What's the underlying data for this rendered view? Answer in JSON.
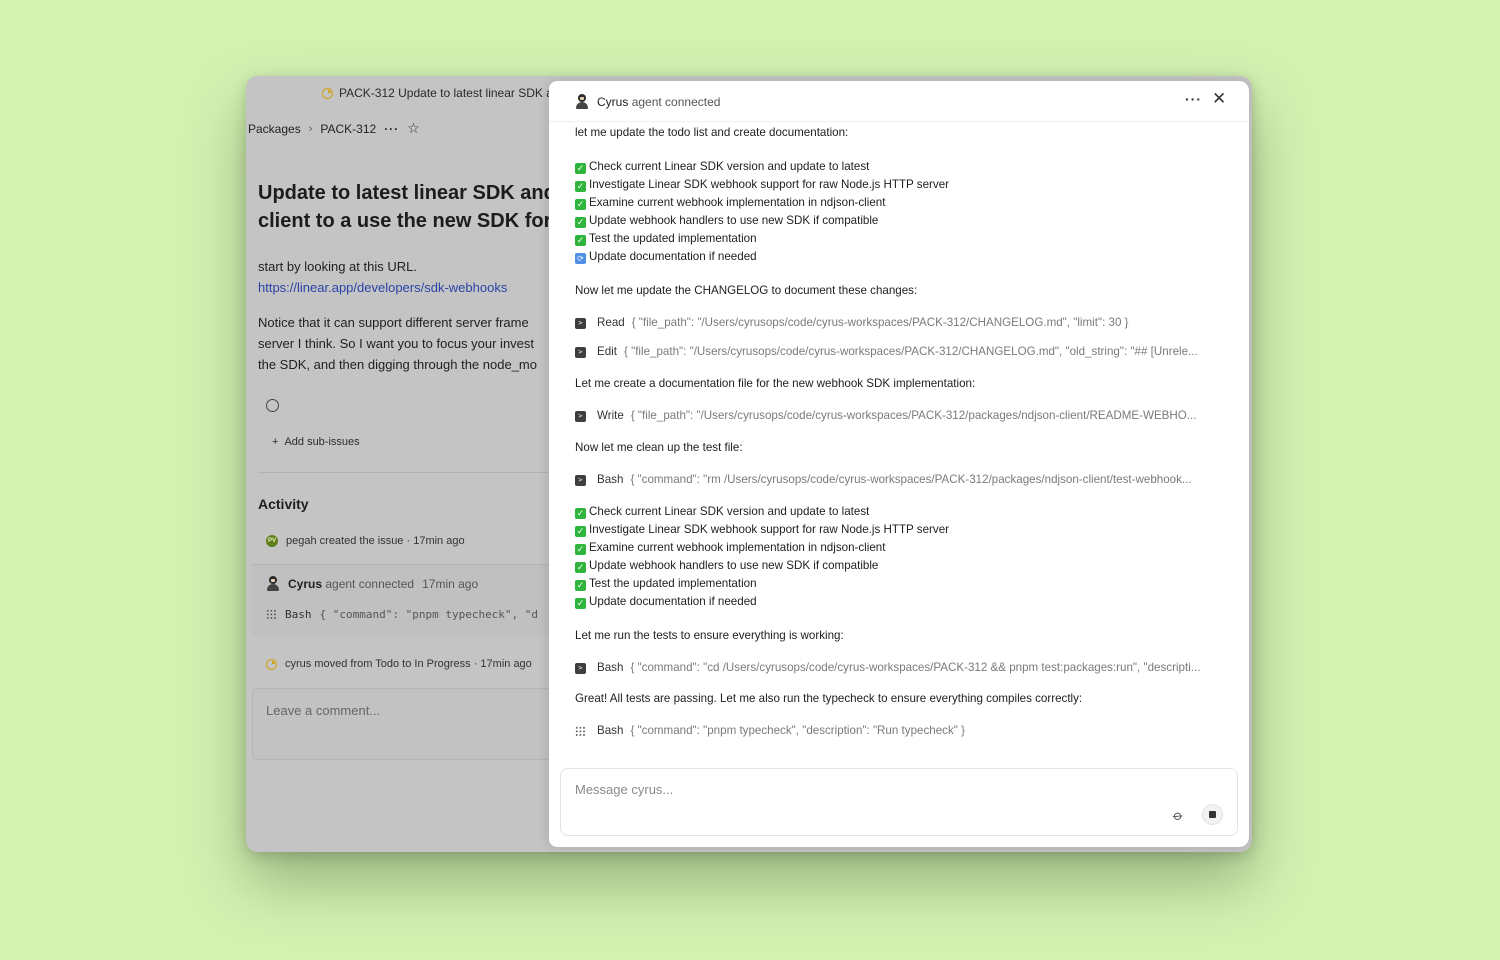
{
  "issue_window": {
    "tab_title": "PACK-312 Update to latest linear SDK a",
    "breadcrumb": [
      "Packages",
      "PACK-312"
    ],
    "breadcrumb_more": "···",
    "title_line1": "Update to latest linear SDK and",
    "title_line2": "client to a use the new SDK for w",
    "body_line1": "start by looking at this URL.",
    "body_link": "https://linear.app/developers/sdk-webhooks",
    "body_line3": "Notice that it can support different server frame",
    "body_line4": "server I think. So I want you to focus your invest",
    "body_line5": "the SDK, and then digging through the node_mo",
    "add_sub_issues": "Add sub-issues",
    "activity_heading": "Activity",
    "activity": {
      "created_user": "pegah",
      "created_text": "created the issue",
      "created_time": "· 17min ago",
      "created_avatar": "PV",
      "agent_name": "Cyrus",
      "agent_status": "agent connected",
      "agent_time": "17min ago",
      "agent_tool": "Bash",
      "agent_tool_args": "{ \"command\": \"pnpm typecheck\", \"d",
      "moved_text": "cyrus moved from Todo to In Progress · 17min ago"
    },
    "comment_placeholder": "Leave a comment..."
  },
  "panel": {
    "agent_name": "Cyrus",
    "agent_status": "agent connected",
    "more_label": "···",
    "close_label": "✕",
    "message_placeholder": "Message cyrus..."
  },
  "feed": {
    "intro": "let me update the todo list and create documentation:",
    "todos1": [
      {
        "mark": "✓",
        "text": "Check current Linear SDK version and update to latest"
      },
      {
        "mark": "✓",
        "text": "Investigate Linear SDK webhook support for raw Node.js HTTP server"
      },
      {
        "mark": "✓",
        "text": "Examine current webhook implementation in ndjson-client"
      },
      {
        "mark": "✓",
        "text": "Update webhook handlers to use new SDK if compatible"
      },
      {
        "mark": "✓",
        "text": "Test the updated implementation"
      },
      {
        "mark": "⟳",
        "text": "Update documentation if needed"
      }
    ],
    "changelog_msg": "Now let me update the CHANGELOG to document these changes:",
    "tool_read": {
      "name": "Read",
      "args": "{ \"file_path\": \"/Users/cyrusops/code/cyrus-workspaces/PACK-312/CHANGELOG.md\", \"limit\": 30 }"
    },
    "tool_edit": {
      "name": "Edit",
      "args": "{ \"file_path\": \"/Users/cyrusops/code/cyrus-workspaces/PACK-312/CHANGELOG.md\", \"old_string\": \"## [Unrele..."
    },
    "doc_msg": "Let me create a documentation file for the new webhook SDK implementation:",
    "tool_write": {
      "name": "Write",
      "args": "{ \"file_path\": \"/Users/cyrusops/code/cyrus-workspaces/PACK-312/packages/ndjson-client/README-WEBHO..."
    },
    "cleanup_msg": "Now let me clean up the test file:",
    "tool_bash1": {
      "name": "Bash",
      "args": "{ \"command\": \"rm /Users/cyrusops/code/cyrus-workspaces/PACK-312/packages/ndjson-client/test-webhook..."
    },
    "todos2": [
      {
        "mark": "✓",
        "text": "Check current Linear SDK version and update to latest"
      },
      {
        "mark": "✓",
        "text": "Investigate Linear SDK webhook support for raw Node.js HTTP server"
      },
      {
        "mark": "✓",
        "text": "Examine current webhook implementation in ndjson-client"
      },
      {
        "mark": "✓",
        "text": "Update webhook handlers to use new SDK if compatible"
      },
      {
        "mark": "✓",
        "text": "Test the updated implementation"
      },
      {
        "mark": "✓",
        "text": "Update documentation if needed"
      }
    ],
    "tests_msg": "Let me run the tests to ensure everything is working:",
    "tool_bash2": {
      "name": "Bash",
      "args": "{ \"command\": \"cd /Users/cyrusops/code/cyrus-workspaces/PACK-312 && pnpm test:packages:run\", \"descripti..."
    },
    "passing_msg": "Great! All tests are passing. Let me also run the typecheck to ensure everything compiles correctly:",
    "tool_bash3": {
      "name": "Bash",
      "args": "{ \"command\": \"pnpm typecheck\", \"description\": \"Run typecheck\" }"
    }
  },
  "colors": {
    "background": "#d3f2b2",
    "check_green": "#2fb43c",
    "link_blue": "#2b44a8",
    "in_progress_yellow": "#d1a10f"
  }
}
